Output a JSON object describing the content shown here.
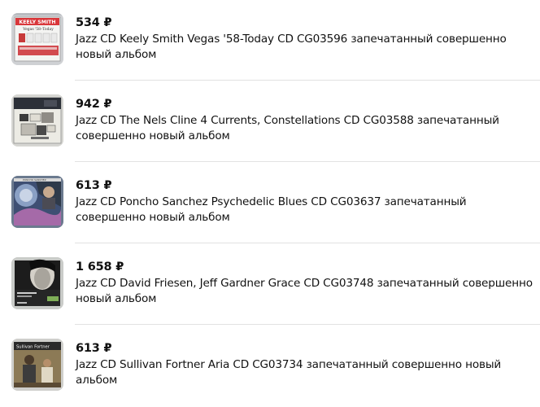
{
  "listings": [
    {
      "price": "534 ₽",
      "title": "Jazz CD Keely Smith Vegas '58-Today CD CG03596 запечатанный совершенно новый альбом",
      "cover_text": "KEELY SMITH",
      "cover_subtext": "Vegas '58–Today",
      "cover_icon": "keely-smith-cover-icon"
    },
    {
      "price": "942 ₽",
      "title": "Jazz CD The Nels Cline 4 Currents, Constellations CD CG03588 запечатанный совершенно новый альбом",
      "cover_icon": "nels-cline-cover-icon"
    },
    {
      "price": "613 ₽",
      "title": "Jazz CD Poncho Sanchez Psychedelic Blues CD CG03637 запечатанный совершенно новый альбом",
      "cover_icon": "poncho-sanchez-cover-icon"
    },
    {
      "price": "1 658 ₽",
      "title": "Jazz CD David Friesen, Jeff Gardner Grace CD CG03748 запечатанный совершенно новый альбом",
      "cover_icon": "david-friesen-cover-icon"
    },
    {
      "price": "613 ₽",
      "title": "Jazz CD Sullivan Fortner Aria CD CG03734 запечатанный совершенно новый альбом",
      "cover_text": "Sullivan Fortner",
      "cover_icon": "sullivan-fortner-cover-icon"
    }
  ]
}
